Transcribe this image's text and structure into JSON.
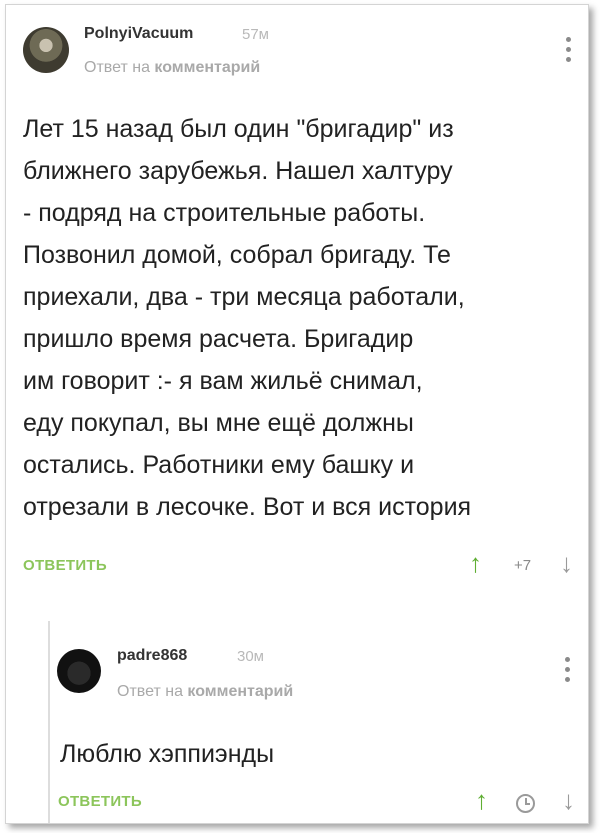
{
  "comment1": {
    "username": "PolnyiVacuum",
    "time": "57м",
    "reply_prefix": "Ответ на",
    "reply_target": "комментарий",
    "body_lines": [
      "Лет 15 назад был один \"бригадир\" из",
      "ближнего зарубежья. Нашел халтуру",
      "- подряд на строительные работы.",
      "Позвонил домой, собрал бригаду. Те",
      "приехали, два - три месяца работали,",
      "пришло время расчета. Бригадир",
      "им говорит :- я вам жильё снимал,",
      "еду покупал, вы мне ещё должны",
      "остались. Работники ему башку и",
      "отрезали в лесочке. Вот и вся история"
    ],
    "reply_label": "ОТВЕТИТЬ",
    "score": "+7",
    "upvote_icon": "arrow-up-icon",
    "downvote_icon": "arrow-down-icon"
  },
  "comment2": {
    "username": "padre868",
    "time": "30м",
    "reply_prefix": "Ответ на",
    "reply_target": "комментарий",
    "body_lines": [
      "Люблю хэппиэнды"
    ],
    "reply_label": "ОТВЕТИТЬ",
    "score_icon": "clock-icon"
  },
  "colors": {
    "accent_green": "#8cc55b",
    "upvote_green": "#5fae33",
    "muted_gray": "#a9a9a9"
  }
}
